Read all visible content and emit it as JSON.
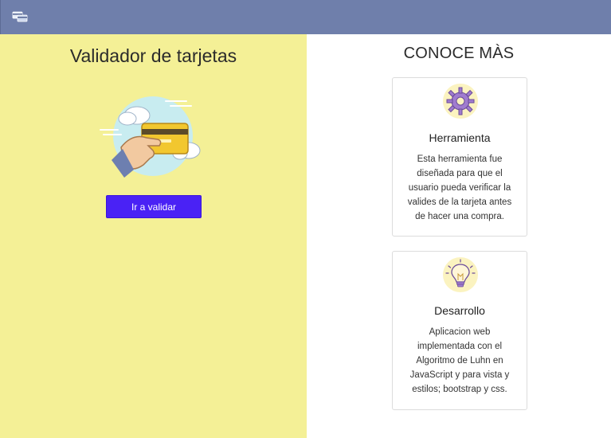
{
  "navbar": {
    "logo_icon": "credit-cards-logo-icon"
  },
  "left": {
    "title": "Validador de tarjetas",
    "illustration_icon": "hand-holding-credit-card-icon",
    "button_label": "Ir a validar",
    "background_color": "#f4f096",
    "button_color": "#4a22f5"
  },
  "right": {
    "title": "CONOCE MÀS",
    "cards": [
      {
        "icon": "gear-icon",
        "title": "Herramienta",
        "text": "Esta herramienta fue diseñada para que el usuario pueda verificar la valides de la tarjeta antes de hacer una compra."
      },
      {
        "icon": "lightbulb-icon",
        "title": "Desarrollo",
        "text": "Aplicacion web implementada con el Algoritmo de Luhn en JavaScript y para vista y estilos; bootstrap y css."
      }
    ]
  },
  "colors": {
    "navbar": "#6f7fab",
    "accent": "#4a22f5",
    "panel": "#f4f096"
  }
}
